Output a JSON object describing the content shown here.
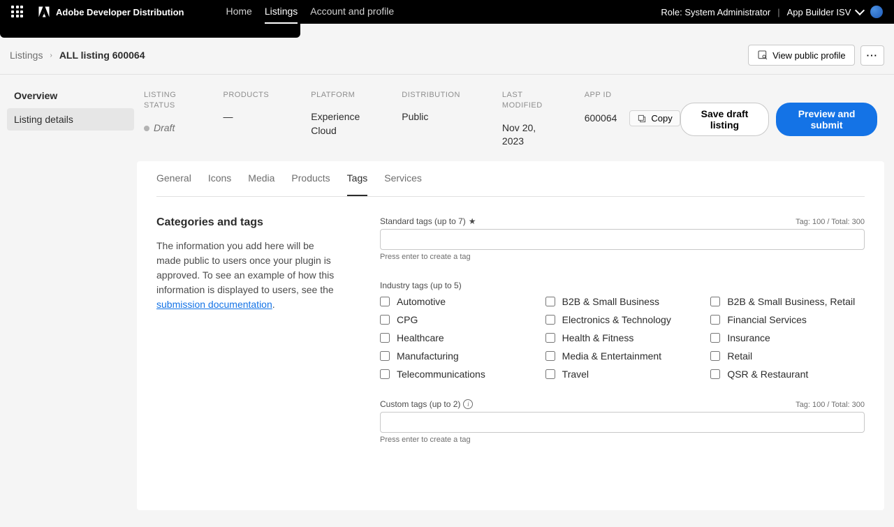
{
  "header": {
    "brand": "Adobe Developer Distribution",
    "nav": {
      "home": "Home",
      "listings": "Listings",
      "account": "Account and profile"
    },
    "role": "Role: System Administrator",
    "org": "App Builder ISV"
  },
  "breadcrumb": {
    "root": "Listings",
    "current": "ALL listing 600064"
  },
  "headerActions": {
    "viewProfile": "View public profile"
  },
  "sidebar": {
    "overview": "Overview",
    "listingDetails": "Listing details"
  },
  "info": {
    "statusLabel": "LISTING STATUS",
    "statusValue": "Draft",
    "productsLabel": "PRODUCTS",
    "productsValue": "—",
    "platformLabel": "PLATFORM",
    "platformValue": "Experience Cloud",
    "distributionLabel": "DISTRIBUTION",
    "distributionValue": "Public",
    "lastModifiedLabel": "LAST MODIFIED",
    "lastModifiedValue": "Nov 20, 2023",
    "appIdLabel": "APP ID",
    "appIdValue": "600064",
    "copy": "Copy"
  },
  "actions": {
    "saveDraft": "Save draft listing",
    "previewSubmit": "Preview and submit"
  },
  "tabs": {
    "general": "General",
    "icons": "Icons",
    "media": "Media",
    "products": "Products",
    "tags": "Tags",
    "services": "Services"
  },
  "tagsPanel": {
    "title": "Categories and tags",
    "descPrefix": "The information you add here will be made public to users once your plugin is approved. To see an example of how this information is displayed to users, see the ",
    "descLink": "submission documentation",
    "standardLabel": "Standard tags (up to 7)",
    "standardLimit": "Tag: 100 / Total: 300",
    "pressEnter": "Press enter to create a tag",
    "industryLabel": "Industry tags (up to 5)",
    "industry": [
      "Automotive",
      "B2B & Small Business",
      "B2B & Small Business, Retail",
      "CPG",
      "Electronics & Technology",
      "Financial Services",
      "Healthcare",
      "Health & Fitness",
      "Insurance",
      "Manufacturing",
      "Media & Entertainment",
      "Retail",
      "Telecommunications",
      "Travel",
      "QSR & Restaurant"
    ],
    "customLabel": "Custom tags (up to 2)",
    "customLimit": "Tag: 100 / Total: 300"
  }
}
